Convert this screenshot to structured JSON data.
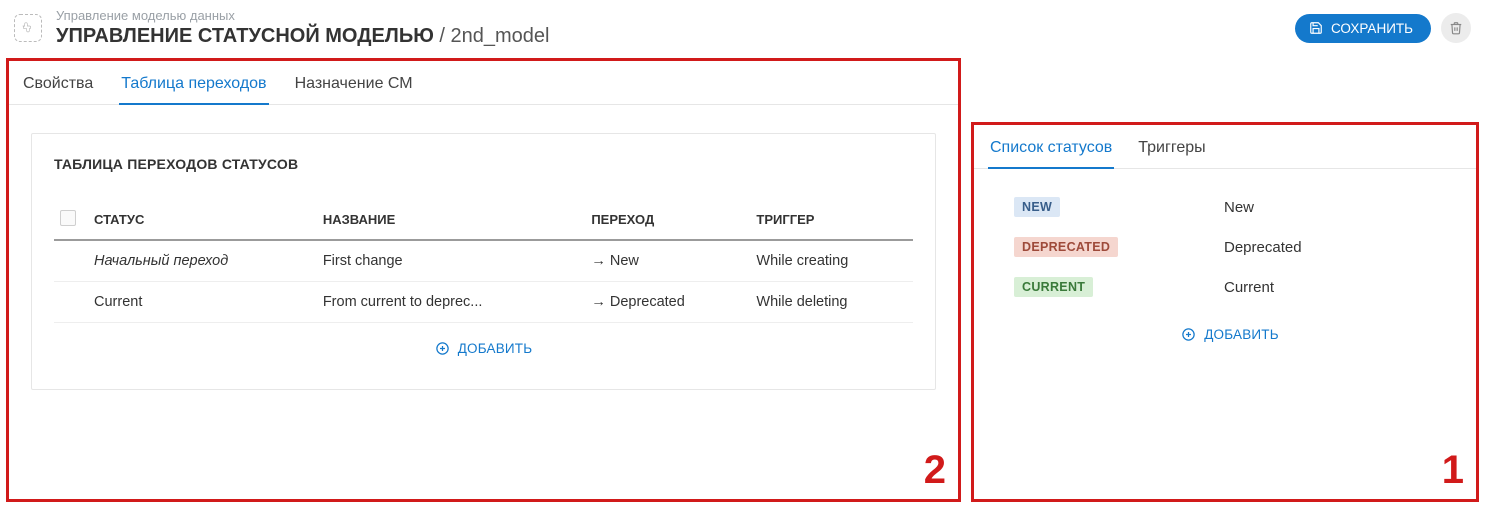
{
  "header": {
    "subtitle": "Управление моделью данных",
    "title_main": "УПРАВЛЕНИЕ СТАТУСНОЙ МОДЕЛЬЮ",
    "title_sep": " / ",
    "title_model": "2nd_model",
    "save_label": "СОХРАНИТЬ"
  },
  "left": {
    "tabs": [
      "Свойства",
      "Таблица переходов",
      "Назначение СМ"
    ],
    "active_tab": 1,
    "card_title": "ТАБЛИЦА ПЕРЕХОДОВ СТАТУСОВ",
    "columns": {
      "status": "СТАТУС",
      "name": "НАЗВАНИЕ",
      "transition": "ПЕРЕХОД",
      "trigger": "ТРИГГЕР"
    },
    "rows": [
      {
        "status": "Начальный переход",
        "initial": true,
        "name": "First change",
        "transition": "→ New",
        "trigger": "While creating"
      },
      {
        "status": "Current",
        "initial": false,
        "name": "From current to deprec...",
        "transition": "→ Deprecated",
        "trigger": "While deleting"
      }
    ],
    "add_label": "ДОБАВИТЬ",
    "annotation": "2"
  },
  "right": {
    "tabs": [
      "Список статусов",
      "Триггеры"
    ],
    "active_tab": 0,
    "statuses": [
      {
        "tag": "NEW",
        "tag_class": "tag-new",
        "label": "New"
      },
      {
        "tag": "DEPRECATED",
        "tag_class": "tag-deprecated",
        "label": "Deprecated"
      },
      {
        "tag": "CURRENT",
        "tag_class": "tag-current",
        "label": "Current"
      }
    ],
    "add_label": "ДОБАВИТЬ",
    "annotation": "1"
  }
}
